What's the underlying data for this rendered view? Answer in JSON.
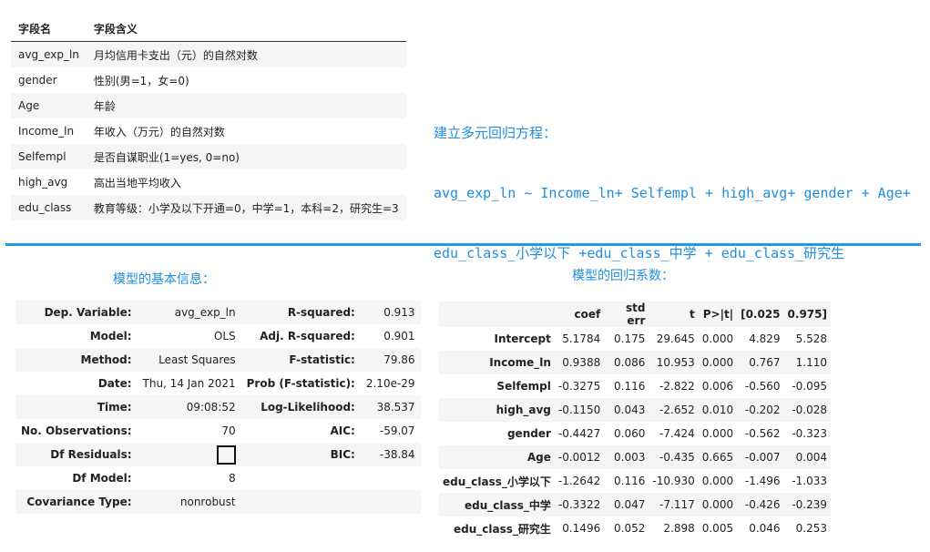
{
  "fields": {
    "headers": [
      "字段名",
      "字段含义"
    ],
    "rows": [
      {
        "name": "avg_exp_ln",
        "meaning": "月均信用卡支出（元）的自然对数"
      },
      {
        "name": "gender",
        "meaning": "性别(男=1，女=0)"
      },
      {
        "name": "Age",
        "meaning": "年龄"
      },
      {
        "name": "Income_ln",
        "meaning": "年收入（万元）的自然对数"
      },
      {
        "name": "Selfempl",
        "meaning": "是否自谋职业(1=yes, 0=no)"
      },
      {
        "name": "high_avg",
        "meaning": "高出当地平均收入"
      },
      {
        "name": "edu_class",
        "meaning": "教育等级：小学及以下开通=0，中学=1，本科=2，研究生=3"
      }
    ]
  },
  "equation": {
    "line1": "建立多元回归方程：",
    "line2": "avg_exp_ln ~ Income_ln+ Selfempl + high_avg+ gender + Age+",
    "line3": "edu_class_小学以下 +edu_class_中学 + edu_class_研究生"
  },
  "info": {
    "title": "模型的基本信息：",
    "rows": [
      {
        "k1": "Dep. Variable:",
        "v1": "avg_exp_ln",
        "k2": "R-squared:",
        "v2": "0.913"
      },
      {
        "k1": "Model:",
        "v1": "OLS",
        "k2": "Adj. R-squared:",
        "v2": "0.901"
      },
      {
        "k1": "Method:",
        "v1": "Least Squares",
        "k2": "F-statistic:",
        "v2": "79.86"
      },
      {
        "k1": "Date:",
        "v1": "Thu, 14 Jan 2021",
        "k2": "Prob (F-statistic):",
        "v2": "2.10e-29"
      },
      {
        "k1": "Time:",
        "v1": "09:08:52",
        "k2": "Log-Likelihood:",
        "v2": "38.537"
      },
      {
        "k1": "No. Observations:",
        "v1": "70",
        "k2": "AIC:",
        "v2": "-59.07"
      },
      {
        "k1": "Df Residuals:",
        "v1": "",
        "k2": "BIC:",
        "v2": "-38.84"
      },
      {
        "k1": "Df Model:",
        "v1": "8",
        "k2": "",
        "v2": ""
      },
      {
        "k1": "Covariance Type:",
        "v1": "nonrobust",
        "k2": "",
        "v2": ""
      }
    ]
  },
  "coef": {
    "title": "模型的回归系数：",
    "headers": [
      "",
      "coef",
      "std err",
      "t",
      "P>|t|",
      "[0.025",
      "0.975]"
    ],
    "rows": [
      [
        "Intercept",
        "5.1784",
        "0.175",
        "29.645",
        "0.000",
        "4.829",
        "5.528"
      ],
      [
        "Income_ln",
        "0.9388",
        "0.086",
        "10.953",
        "0.000",
        "0.767",
        "1.110"
      ],
      [
        "Selfempl",
        "-0.3275",
        "0.116",
        "-2.822",
        "0.006",
        "-0.560",
        "-0.095"
      ],
      [
        "high_avg",
        "-0.1150",
        "0.043",
        "-2.652",
        "0.010",
        "-0.202",
        "-0.028"
      ],
      [
        "gender",
        "-0.4427",
        "0.060",
        "-7.424",
        "0.000",
        "-0.562",
        "-0.323"
      ],
      [
        "Age",
        "-0.0012",
        "0.003",
        "-0.435",
        "0.665",
        "-0.007",
        "0.004"
      ],
      [
        "edu_class_小学以下",
        "-1.2642",
        "0.116",
        "-10.930",
        "0.000",
        "-1.496",
        "-1.033"
      ],
      [
        "edu_class_中学",
        "-0.3322",
        "0.047",
        "-7.117",
        "0.000",
        "-0.426",
        "-0.239"
      ],
      [
        "edu_class_研究生",
        "0.1496",
        "0.052",
        "2.898",
        "0.005",
        "0.046",
        "0.253"
      ]
    ]
  }
}
